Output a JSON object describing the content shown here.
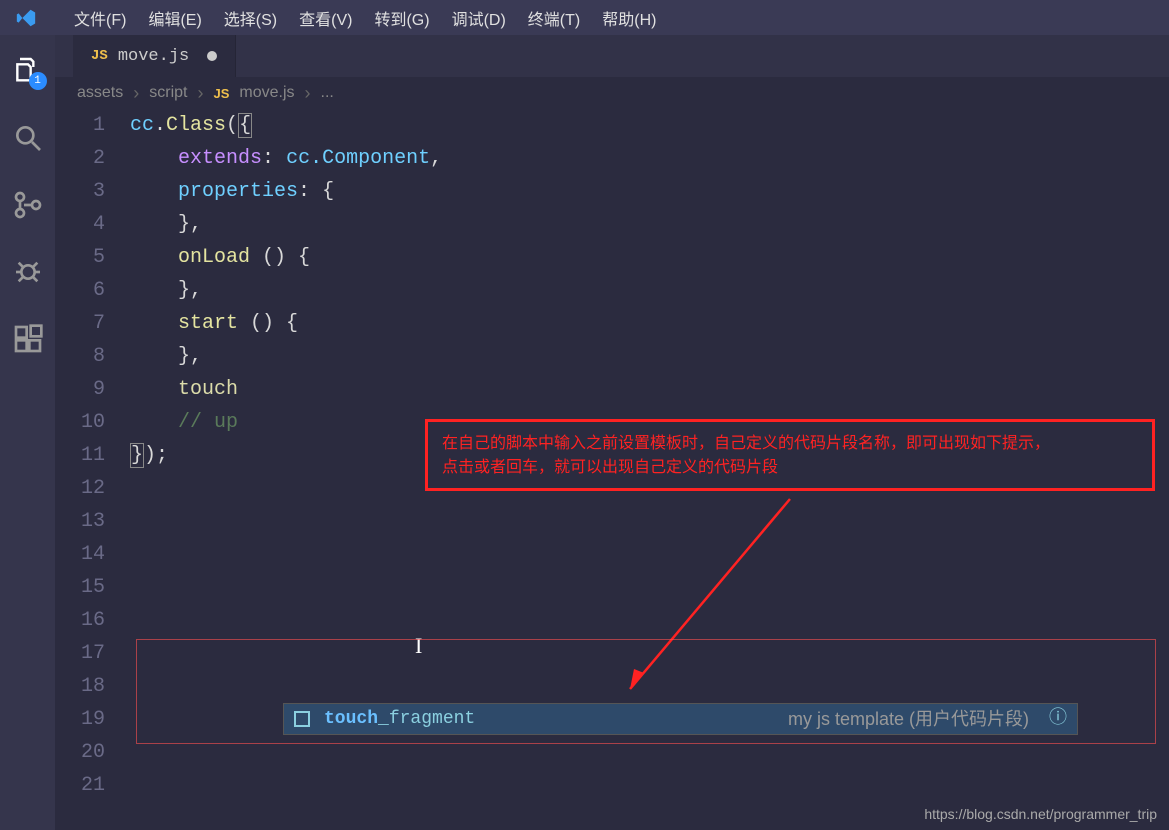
{
  "menu": {
    "file": "文件(F)",
    "edit": "编辑(E)",
    "select": "选择(S)",
    "view": "查看(V)",
    "goto": "转到(G)",
    "debug": "调试(D)",
    "terminal": "终端(T)",
    "help": "帮助(H)"
  },
  "activity": {
    "explorer_badge": "1"
  },
  "tab": {
    "icon": "JS",
    "name": "move.js"
  },
  "breadcrumb": {
    "seg1": "assets",
    "seg2": "script",
    "seg3_icon": "JS",
    "seg3": "move.js",
    "ellipsis": "..."
  },
  "lines": {
    "1": "1",
    "2": "2",
    "3": "3",
    "4": "4",
    "5": "5",
    "6": "6",
    "7": "7",
    "8": "8",
    "9": "9",
    "10": "10",
    "11": "11",
    "12": "12",
    "13": "13",
    "14": "14",
    "15": "15",
    "16": "16",
    "17": "17",
    "18": "18",
    "19": "19",
    "20": "20",
    "21": "21"
  },
  "code": {
    "cc": "cc",
    "class": "Class",
    "extends": "extends",
    "component": "cc.Component",
    "properties": "properties",
    "onload": "onLoad",
    "start": "start",
    "touch": "touch",
    "update_comment": "// up",
    "paren_open": "(",
    "paren_close": ")",
    "brace_open": "{",
    "brace_close": "}",
    "colon": ":",
    "comma": ",",
    "semicolon": ";",
    "empty_parens": " () {",
    "close_comma": "},",
    "close_all": "});"
  },
  "annotation": {
    "line1": "在自己的脚本中输入之前设置模板时，自己定义的代码片段名称，即可出现如下提示，",
    "line2": "点击或者回车，就可以出现自己定义的代码片段"
  },
  "suggest": {
    "match": "touch",
    "rest": "_fragment",
    "detail": "my js template (用户代码片段)",
    "info_icon": "ⓘ"
  },
  "watermark": "https://blog.csdn.net/programmer_trip"
}
